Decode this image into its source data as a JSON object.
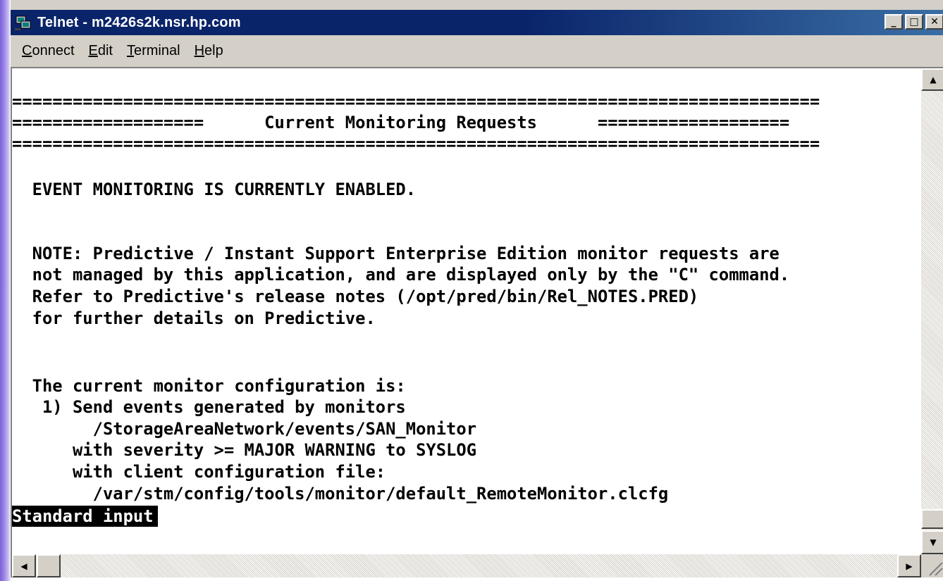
{
  "window": {
    "title": "Telnet - m2426s2k.nsr.hp.com",
    "minimize_glyph": "_",
    "maximize_glyph": "□",
    "close_glyph": "✕"
  },
  "menu": [
    {
      "accel": "C",
      "rest": "onnect"
    },
    {
      "accel": "E",
      "rest": "dit"
    },
    {
      "accel": "T",
      "rest": "erminal"
    },
    {
      "accel": "H",
      "rest": "elp"
    }
  ],
  "terminal": {
    "lines": [
      "",
      "================================================================================",
      "===================      Current Monitoring Requests      ===================",
      "================================================================================",
      "",
      "  EVENT MONITORING IS CURRENTLY ENABLED.",
      "",
      "",
      "  NOTE: Predictive / Instant Support Enterprise Edition monitor requests are",
      "  not managed by this application, and are displayed only by the \"C\" command.",
      "  Refer to Predictive's release notes (/opt/pred/bin/Rel_NOTES.PRED)",
      "  for further details on Predictive.",
      "",
      "",
      "  The current monitor configuration is:",
      "   1) Send events generated by monitors",
      "        /StorageAreaNetwork/events/SAN_Monitor",
      "      with severity >= MAJOR WARNING to SYSLOG",
      "      with client configuration file:",
      "        /var/stm/config/tools/monitor/default_RemoteMonitor.clcfg",
      "Standard input"
    ],
    "status_line": "Standard input"
  },
  "scrollbars": {
    "up_arrow": "▲",
    "down_arrow": "▼",
    "left_arrow": "◀",
    "right_arrow": "▶"
  }
}
